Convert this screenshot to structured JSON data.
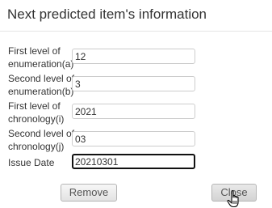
{
  "dialog": {
    "title": "Next predicted item's information"
  },
  "fields": [
    {
      "label_line1": "First level of",
      "label_line2": "enumeration(a)",
      "value": "12"
    },
    {
      "label_line1": "Second level of",
      "label_line2": "enumeration(b)",
      "value": "3"
    },
    {
      "label_line1": "First level of",
      "label_line2": "chronology(i)",
      "value": "2021"
    },
    {
      "label_line1": "Second level of",
      "label_line2": "chronology(j)",
      "value": "03"
    },
    {
      "label_line1": "Issue Date",
      "value": "20210301"
    }
  ],
  "buttons": {
    "remove_label": "Remove",
    "close_label": "Close"
  },
  "icons": {
    "cursor": "hand-pointer-icon"
  }
}
